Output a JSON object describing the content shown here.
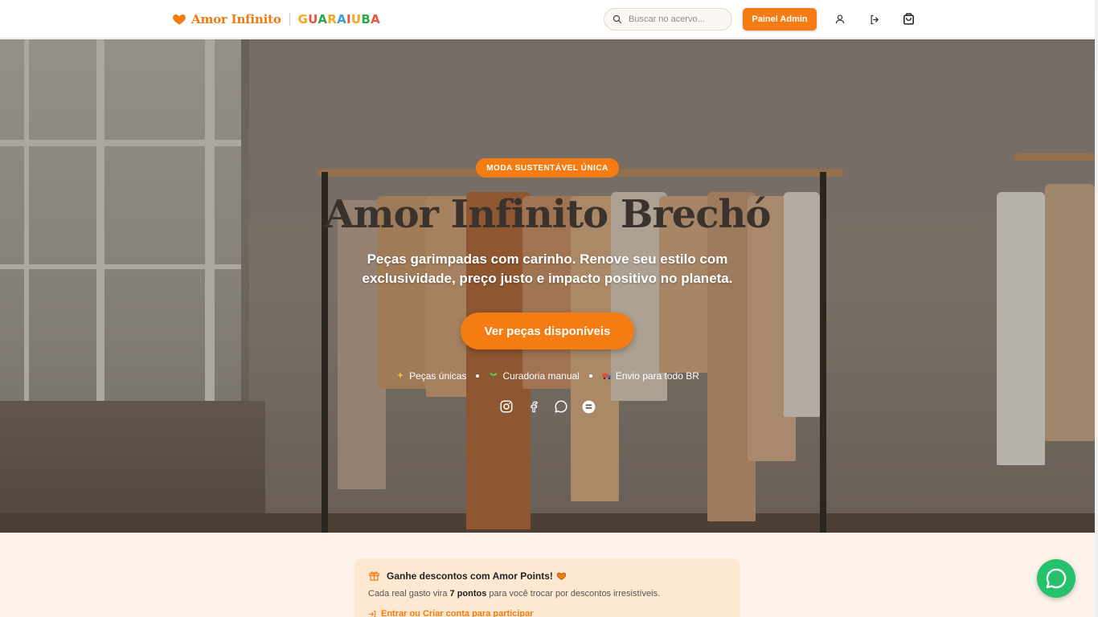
{
  "header": {
    "brand": "Amor Infinito",
    "partner_letters": [
      "G",
      "U",
      "A",
      "R",
      "A",
      "I",
      "U",
      "B",
      "A"
    ],
    "search_placeholder": "Buscar no acervo...",
    "admin_button": "Painel Admin",
    "icons": [
      "user-icon",
      "logout-icon",
      "cart-icon"
    ]
  },
  "hero": {
    "badge": "MODA SUSTENTÁVEL ÚNICA",
    "title": "Amor Infinito Brechó",
    "subtitle": "Peças garimpadas com carinho. Renove seu estilo com exclusividade, preço justo e impacto positivo no planeta.",
    "cta": "Ver peças disponíveis",
    "features": [
      {
        "icon": "sparkles-icon",
        "label": "Peças únicas"
      },
      {
        "icon": "seedling-icon",
        "label": "Curadoria manual"
      },
      {
        "icon": "truck-icon",
        "label": "Envio para todo BR"
      }
    ],
    "socials": [
      "instagram-icon",
      "facebook-icon",
      "chat-icon",
      "store-icon"
    ]
  },
  "points": {
    "title": "Ganhe descontos com Amor Points!",
    "desc_prefix": "Cada real gasto vira",
    "desc_highlight": "7 pontos",
    "desc_suffix": "para você trocar por descontos irresistíveis.",
    "link": "Entrar ou Criar conta para participar"
  },
  "colors": {
    "accent": "#f57c12",
    "whatsapp": "#25c26b",
    "cream": "#fdf3ea"
  }
}
